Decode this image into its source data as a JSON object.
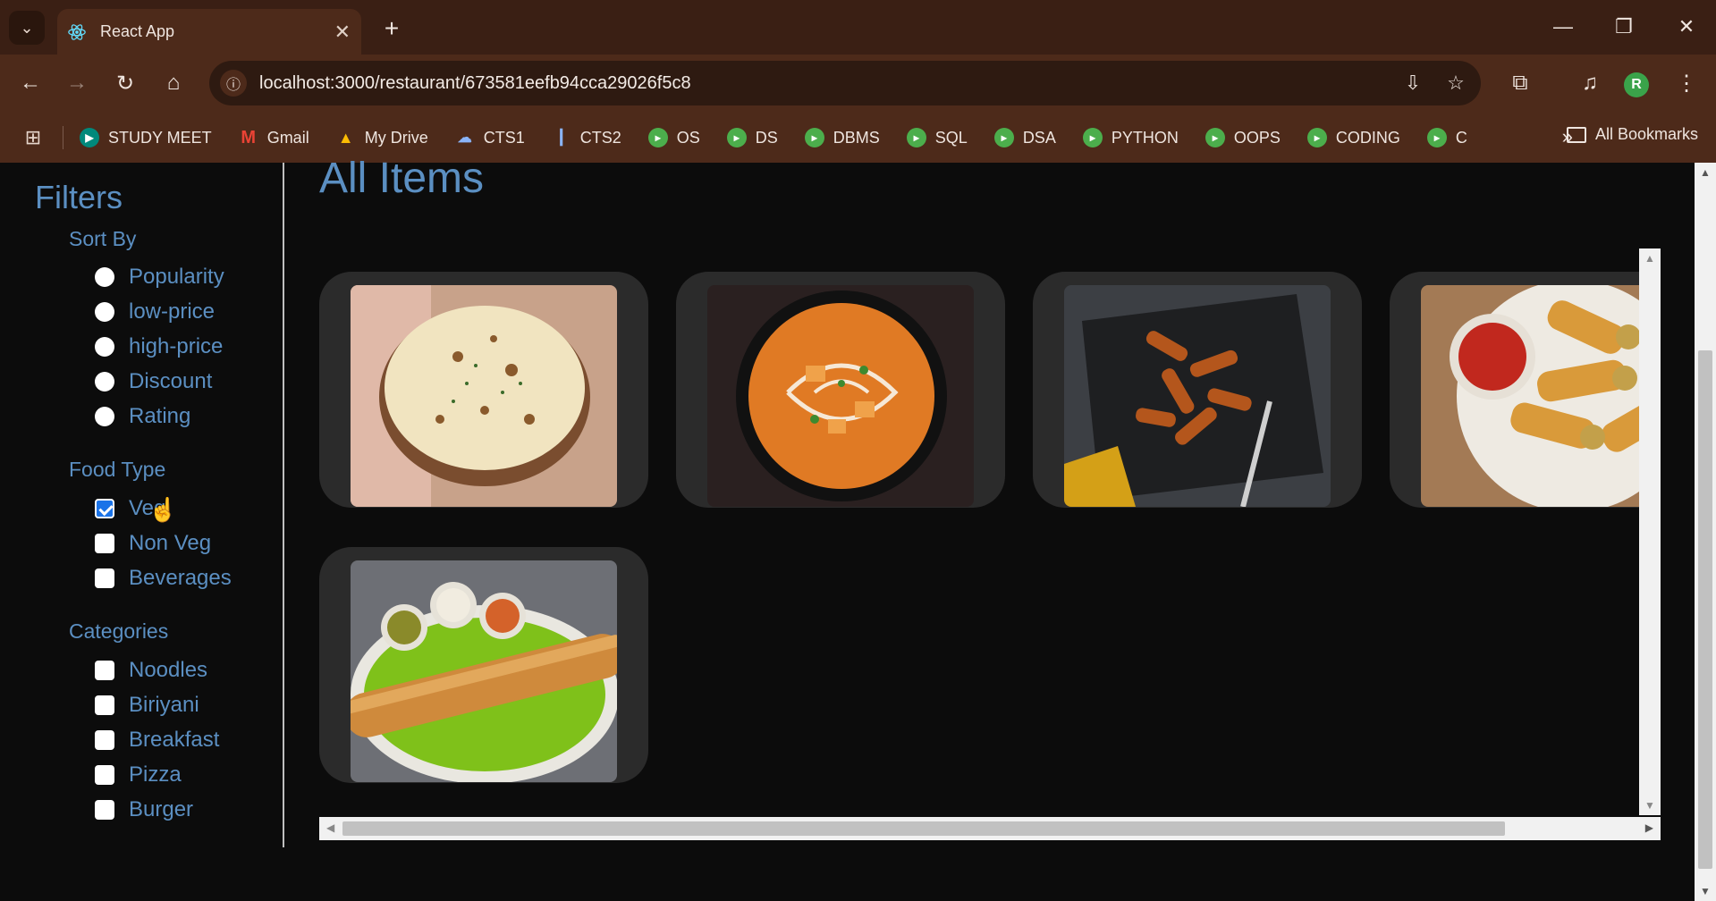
{
  "browser": {
    "tab_title": "React App",
    "url": "localhost:3000/restaurant/673581eefb94cca29026f5c8",
    "profile_initial": "R",
    "bookmarks": [
      {
        "label": "STUDY MEET",
        "icon": "meet-icon"
      },
      {
        "label": "Gmail",
        "icon": "gmail-icon"
      },
      {
        "label": "My Drive",
        "icon": "drive-icon"
      },
      {
        "label": "CTS1",
        "icon": "cloud-icon"
      },
      {
        "label": "CTS2",
        "icon": "chart-icon"
      },
      {
        "label": "OS",
        "icon": "bookmark-icon"
      },
      {
        "label": "DS",
        "icon": "bookmark-icon"
      },
      {
        "label": "DBMS",
        "icon": "bookmark-icon"
      },
      {
        "label": "SQL",
        "icon": "bookmark-icon"
      },
      {
        "label": "DSA",
        "icon": "bookmark-icon"
      },
      {
        "label": "PYTHON",
        "icon": "bookmark-icon"
      },
      {
        "label": "OOPS",
        "icon": "bookmark-icon"
      },
      {
        "label": "CODING",
        "icon": "bookmark-icon"
      },
      {
        "label": "C",
        "icon": "bookmark-icon"
      }
    ],
    "all_bookmarks": "All Bookmarks"
  },
  "filters": {
    "title": "Filters",
    "sort_by": {
      "heading": "Sort By",
      "options": [
        "Popularity",
        "low-price",
        "high-price",
        "Discount",
        "Rating"
      ]
    },
    "food_type": {
      "heading": "Food Type",
      "options": [
        {
          "label": "Veg",
          "checked": true
        },
        {
          "label": "Non Veg",
          "checked": false
        },
        {
          "label": "Beverages",
          "checked": false
        }
      ]
    },
    "categories": {
      "heading": "Categories",
      "options": [
        "Noodles",
        "Biriyani",
        "Breakfast",
        "Pizza",
        "Burger"
      ]
    }
  },
  "main": {
    "title": "All Items",
    "items": [
      {
        "image": "naan",
        "alt": "naan"
      },
      {
        "image": "paneer-curry",
        "alt": "paneer curry"
      },
      {
        "image": "chilli-potato",
        "alt": "honey chilli potato"
      },
      {
        "image": "spring-rolls",
        "alt": "spring rolls"
      },
      {
        "image": "dosa",
        "alt": "dosa"
      }
    ]
  },
  "colors": {
    "accent": "#5b8fc2",
    "chrome": "#4d2a1a",
    "card": "#2b2b2b",
    "checkbox_checked": "#1a73e8"
  }
}
